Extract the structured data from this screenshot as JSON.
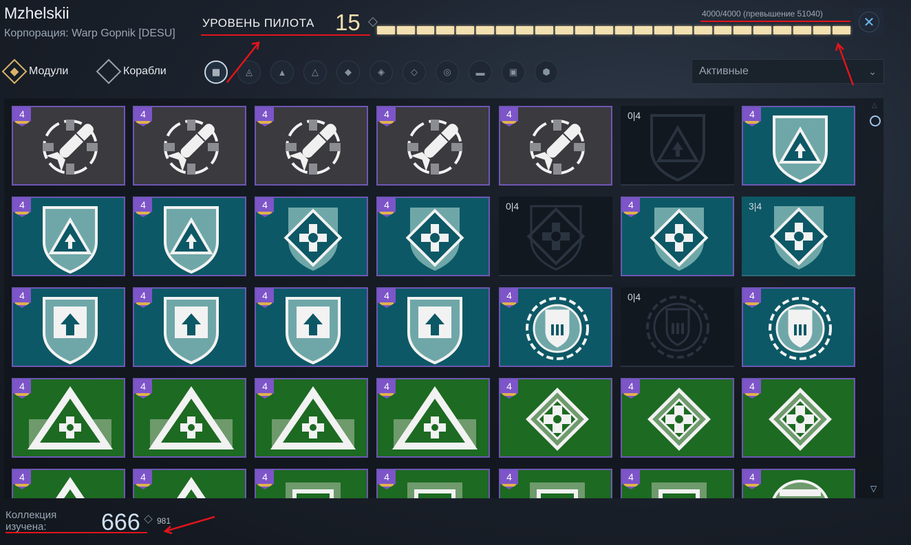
{
  "header": {
    "pilot_name": "Mzhelskii",
    "corporation": "Корпорация: Warp Gopnik [DESU]",
    "level_label": "УРОВЕНЬ ПИЛОТА",
    "level_value": "15",
    "xp_text": "4000/4000 (превышение 51040)",
    "xp_progress": 1.0,
    "close_icon": "close-icon"
  },
  "tabs": [
    {
      "label": "Модули",
      "active": true
    },
    {
      "label": "Корабли",
      "active": false
    }
  ],
  "filters": [
    "grid-icon",
    "fighter-icon",
    "frigate-icon",
    "destroyer-icon",
    "cruiser-icon",
    "battleship-icon",
    "carrier-icon",
    "weapon-icon",
    "module-icon",
    "support-icon",
    "shield-icon"
  ],
  "select": {
    "value": "Активные"
  },
  "cards": [
    {
      "type": "rocket",
      "badge": "4"
    },
    {
      "type": "rocket",
      "badge": "4"
    },
    {
      "type": "rocket",
      "badge": "4"
    },
    {
      "type": "rocket",
      "badge": "4"
    },
    {
      "type": "rocket",
      "badge": "4"
    },
    {
      "type": "locked",
      "count": "0|4",
      "icon": "shield"
    },
    {
      "type": "teal",
      "badge": "4",
      "icon": "shield"
    },
    {
      "type": "teal",
      "badge": "4",
      "icon": "shield"
    },
    {
      "type": "teal",
      "badge": "4",
      "icon": "shield"
    },
    {
      "type": "teal",
      "badge": "4",
      "icon": "cross"
    },
    {
      "type": "teal",
      "badge": "4",
      "icon": "cross"
    },
    {
      "type": "locked",
      "count": "0|4",
      "icon": "cross"
    },
    {
      "type": "teal",
      "badge": "4",
      "icon": "cross"
    },
    {
      "type": "partial",
      "count": "3|4",
      "icon": "cross"
    },
    {
      "type": "teal",
      "badge": "4",
      "icon": "arrow"
    },
    {
      "type": "teal",
      "badge": "4",
      "icon": "arrow"
    },
    {
      "type": "teal",
      "badge": "4",
      "icon": "arrow"
    },
    {
      "type": "teal",
      "badge": "4",
      "icon": "arrow"
    },
    {
      "type": "teal",
      "badge": "4",
      "icon": "circle"
    },
    {
      "type": "locked",
      "count": "0|4",
      "icon": "circle"
    },
    {
      "type": "teal",
      "badge": "4",
      "icon": "circle"
    },
    {
      "type": "green",
      "badge": "4",
      "icon": "triangle"
    },
    {
      "type": "green",
      "badge": "4",
      "icon": "triangle"
    },
    {
      "type": "green",
      "badge": "4",
      "icon": "triangle"
    },
    {
      "type": "green",
      "badge": "4",
      "icon": "triangle"
    },
    {
      "type": "green",
      "badge": "4",
      "icon": "diamond"
    },
    {
      "type": "green",
      "badge": "4",
      "icon": "diamond"
    },
    {
      "type": "green",
      "badge": "4",
      "icon": "diamond"
    },
    {
      "type": "green",
      "badge": "4",
      "icon": "triangle"
    },
    {
      "type": "green",
      "badge": "4",
      "icon": "triangle"
    },
    {
      "type": "green",
      "badge": "4",
      "icon": "box"
    },
    {
      "type": "green",
      "badge": "4",
      "icon": "box"
    },
    {
      "type": "green",
      "badge": "4",
      "icon": "box"
    },
    {
      "type": "green",
      "badge": "4",
      "icon": "box"
    },
    {
      "type": "green",
      "badge": "4",
      "icon": "round"
    }
  ],
  "footer": {
    "collection_label": "Коллекция изучена:",
    "collection_value": "666",
    "collection_total": "981"
  },
  "colors": {
    "accent_gold": "#d9b46a",
    "xp_bar": "#f3e0b0",
    "badge_purple": "#7d55c9",
    "teal": "#0d5866",
    "green": "#1d6a22",
    "annotation_red": "#e3141b"
  }
}
